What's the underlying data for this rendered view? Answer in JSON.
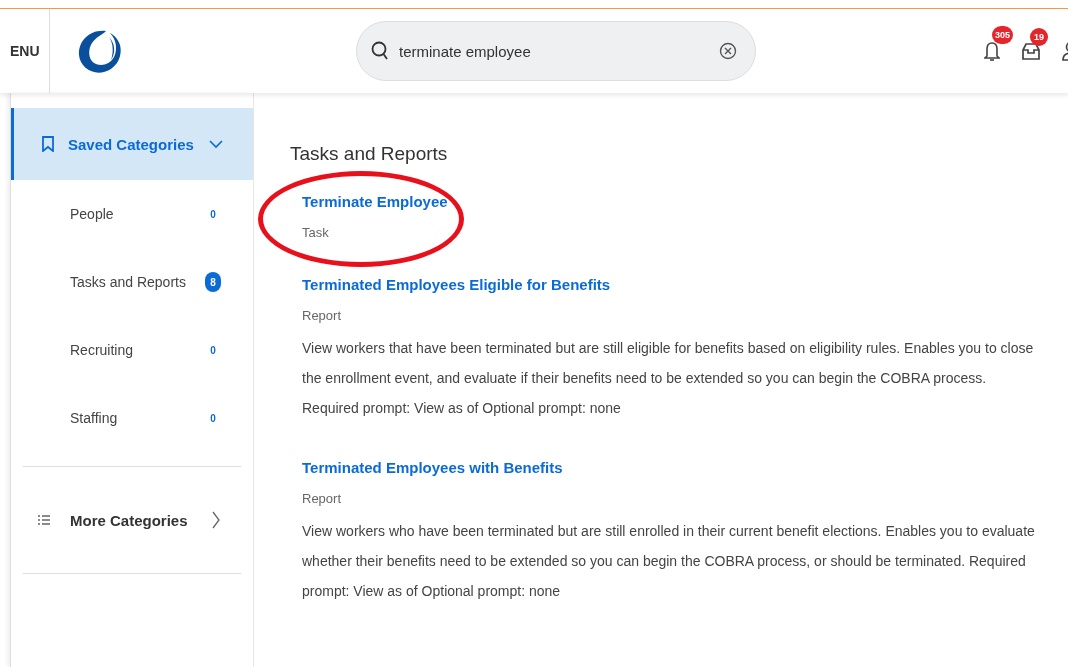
{
  "header": {
    "menu_label": "ENU",
    "search": {
      "value": "terminate employee"
    },
    "notifications": {
      "count": "305"
    },
    "inbox": {
      "count": "19"
    }
  },
  "sidebar": {
    "saved": {
      "label": "Saved Categories",
      "expanded": true,
      "selected": true
    },
    "categories": [
      {
        "label": "People",
        "count": "0",
        "highlighted": false
      },
      {
        "label": "Tasks and Reports",
        "count": "8",
        "highlighted": true
      },
      {
        "label": "Recruiting",
        "count": "0",
        "highlighted": false
      },
      {
        "label": "Staffing",
        "count": "0",
        "highlighted": false
      }
    ],
    "more": {
      "label": "More Categories",
      "expanded": false
    }
  },
  "results": {
    "title": "Tasks and Reports",
    "items": [
      {
        "title": "Terminate Employee",
        "type": "Task",
        "circled": true
      },
      {
        "title": "Terminated Employees Eligible for Benefits",
        "type": "Report",
        "description": "View workers that have been terminated but are still eligible for benefits based on eligibility rules. Enables you to close the enrollment event, and evaluate if their benefits need to be extended so you can begin the COBRA process. Required prompt: View as of Optional prompt: none",
        "circled": false
      },
      {
        "title": "Terminated Employees with Benefits",
        "type": "Report",
        "description": "View workers who have been terminated but are still enrolled in their current benefit elections. Enables you to evaluate whether their benefits need to be extended so you can begin the COBRA process, or should be terminated. Required prompt: View as of Optional prompt: none",
        "circled": false
      }
    ]
  }
}
